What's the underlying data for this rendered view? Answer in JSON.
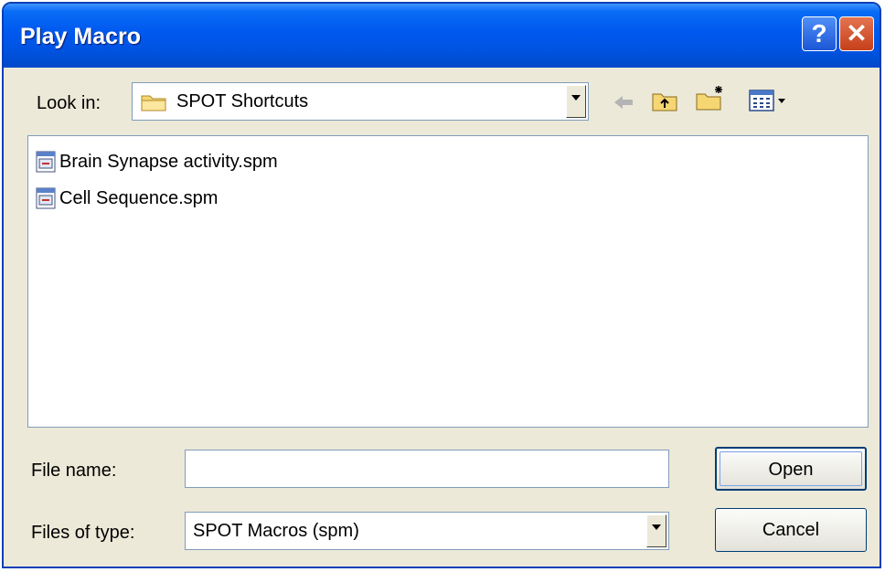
{
  "window": {
    "title": "Play Macro"
  },
  "titlebar": {
    "help_label": "?",
    "close_label": "✕"
  },
  "look_in": {
    "label": "Look in:",
    "value": "SPOT Shortcuts"
  },
  "toolbar": {
    "icons": [
      "back-arrow-icon",
      "up-folder-icon",
      "new-folder-icon",
      "view-menu-icon"
    ]
  },
  "files": [
    {
      "name": "Brain Synapse activity.spm"
    },
    {
      "name": "Cell Sequence.spm"
    }
  ],
  "file_name": {
    "label": "File name:",
    "value": ""
  },
  "file_type": {
    "label": "Files of type:",
    "value": "SPOT Macros (spm)"
  },
  "buttons": {
    "open": "Open",
    "cancel": "Cancel"
  },
  "colors": {
    "titlebar": "#0054e3",
    "dialog": "#ece9d8",
    "close": "#c5401a"
  }
}
